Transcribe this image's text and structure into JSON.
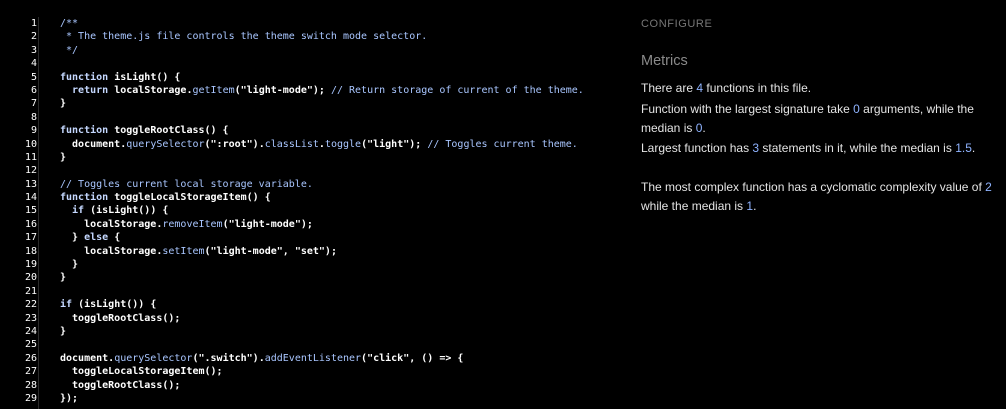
{
  "editor": {
    "lines": [
      {
        "n": "1",
        "tokens": [
          {
            "t": "/**",
            "c": "cm"
          }
        ]
      },
      {
        "n": "2",
        "tokens": [
          {
            "t": " * The theme.js file controls the theme switch mode selector.",
            "c": "cm"
          }
        ]
      },
      {
        "n": "3",
        "tokens": [
          {
            "t": " */",
            "c": "cm"
          }
        ]
      },
      {
        "n": "4",
        "tokens": []
      },
      {
        "n": "5",
        "tokens": [
          {
            "t": "function",
            "c": "kw"
          },
          {
            "t": " isLight() {",
            "c": "pl"
          }
        ]
      },
      {
        "n": "6",
        "tokens": [
          {
            "t": "  return",
            "c": "kw"
          },
          {
            "t": " localStorage.",
            "c": "pl"
          },
          {
            "t": "getItem",
            "c": "meth"
          },
          {
            "t": "(\"light-mode\");",
            "c": "pl"
          },
          {
            "t": " // Return storage of current of the theme.",
            "c": "cm"
          }
        ]
      },
      {
        "n": "7",
        "tokens": [
          {
            "t": "}",
            "c": "pl"
          }
        ]
      },
      {
        "n": "8",
        "tokens": []
      },
      {
        "n": "9",
        "tokens": [
          {
            "t": "function",
            "c": "kw"
          },
          {
            "t": " toggleRootClass() {",
            "c": "pl"
          }
        ]
      },
      {
        "n": "10",
        "tokens": [
          {
            "t": "  document.",
            "c": "pl"
          },
          {
            "t": "querySelector",
            "c": "meth"
          },
          {
            "t": "(\":root\").",
            "c": "pl"
          },
          {
            "t": "classList",
            "c": "meth"
          },
          {
            "t": ".",
            "c": "pl"
          },
          {
            "t": "toggle",
            "c": "meth"
          },
          {
            "t": "(\"light\");",
            "c": "pl"
          },
          {
            "t": " // Toggles current theme.",
            "c": "cm"
          }
        ]
      },
      {
        "n": "11",
        "tokens": [
          {
            "t": "}",
            "c": "pl"
          }
        ]
      },
      {
        "n": "12",
        "tokens": []
      },
      {
        "n": "13",
        "tokens": [
          {
            "t": "// Toggles current local storage variable.",
            "c": "cm"
          }
        ]
      },
      {
        "n": "14",
        "tokens": [
          {
            "t": "function",
            "c": "kw"
          },
          {
            "t": " toggleLocalStorageItem() {",
            "c": "pl"
          }
        ]
      },
      {
        "n": "15",
        "tokens": [
          {
            "t": "  if",
            "c": "kw"
          },
          {
            "t": " (isLight()) {",
            "c": "pl"
          }
        ]
      },
      {
        "n": "16",
        "tokens": [
          {
            "t": "    localStorage.",
            "c": "pl"
          },
          {
            "t": "removeItem",
            "c": "meth"
          },
          {
            "t": "(\"light-mode\");",
            "c": "pl"
          }
        ]
      },
      {
        "n": "17",
        "tokens": [
          {
            "t": "  } ",
            "c": "pl"
          },
          {
            "t": "else",
            "c": "kw"
          },
          {
            "t": " {",
            "c": "pl"
          }
        ]
      },
      {
        "n": "18",
        "tokens": [
          {
            "t": "    localStorage.",
            "c": "pl"
          },
          {
            "t": "setItem",
            "c": "meth"
          },
          {
            "t": "(\"light-mode\", \"set\");",
            "c": "pl"
          }
        ]
      },
      {
        "n": "19",
        "tokens": [
          {
            "t": "  }",
            "c": "pl"
          }
        ]
      },
      {
        "n": "20",
        "tokens": [
          {
            "t": "}",
            "c": "pl"
          }
        ]
      },
      {
        "n": "21",
        "tokens": []
      },
      {
        "n": "22",
        "tokens": [
          {
            "t": "if",
            "c": "kw"
          },
          {
            "t": " (isLight()) {",
            "c": "pl"
          }
        ]
      },
      {
        "n": "23",
        "tokens": [
          {
            "t": "  toggleRootClass();",
            "c": "pl"
          }
        ]
      },
      {
        "n": "24",
        "tokens": [
          {
            "t": "}",
            "c": "pl"
          }
        ]
      },
      {
        "n": "25",
        "tokens": []
      },
      {
        "n": "26",
        "tokens": [
          {
            "t": "document.",
            "c": "pl"
          },
          {
            "t": "querySelector",
            "c": "meth"
          },
          {
            "t": "(\".switch\").",
            "c": "pl"
          },
          {
            "t": "addEventListener",
            "c": "meth"
          },
          {
            "t": "(\"click\", () => {",
            "c": "pl"
          }
        ]
      },
      {
        "n": "27",
        "tokens": [
          {
            "t": "  toggleLocalStorageItem();",
            "c": "pl"
          }
        ]
      },
      {
        "n": "28",
        "tokens": [
          {
            "t": "  toggleRootClass();",
            "c": "pl"
          }
        ]
      },
      {
        "n": "29",
        "tokens": [
          {
            "t": "});",
            "c": "pl"
          }
        ]
      }
    ]
  },
  "panel": {
    "configure_label": "CONFIGURE",
    "metrics_title": "Metrics",
    "metric1": {
      "a": "There are ",
      "n": "4",
      "b": " functions in this file."
    },
    "metric2": {
      "a": "Function with the largest signature take ",
      "n1": "0",
      "b": " arguments, while the median is ",
      "n2": "0",
      "c": "."
    },
    "metric3": {
      "a": "Largest function has ",
      "n1": "3",
      "b": " statements in it, while the median is ",
      "n2": "1.5",
      "c": "."
    },
    "metric4": {
      "a": "The most complex function has a cyclomatic complexity value of ",
      "n1": "2",
      "b": " while the median is ",
      "n2": "1",
      "c": "."
    }
  }
}
